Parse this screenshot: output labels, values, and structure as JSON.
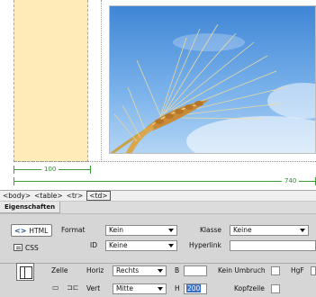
{
  "canvas": {
    "ruler_small": "100",
    "ruler_large": "740"
  },
  "tag_selector": {
    "tags": [
      "<body>",
      "<table>",
      "<tr>",
      "<td>"
    ]
  },
  "properties": {
    "tab_label": "Eigenschaften",
    "html_button": "HTML",
    "css_button": "CSS",
    "format_label": "Format",
    "format_value": "Kein",
    "klasse_label": "Klasse",
    "klasse_value": "Keine",
    "id_label": "ID",
    "id_value": "Keine",
    "hyperlink_label": "Hyperlink",
    "hyperlink_value": "",
    "zelle_label": "Zelle",
    "horz_label": "Horiz",
    "horz_value": "Rechts",
    "vert_label": "Vert",
    "vert_value": "Mitte",
    "b_label": "B",
    "b_value": "",
    "h_label": "H",
    "h_value": "200",
    "kein_umbruch_label": "Kein Umbruch",
    "hgf_label": "HgF",
    "kopfzeile_label": "Kopfzeile"
  }
}
